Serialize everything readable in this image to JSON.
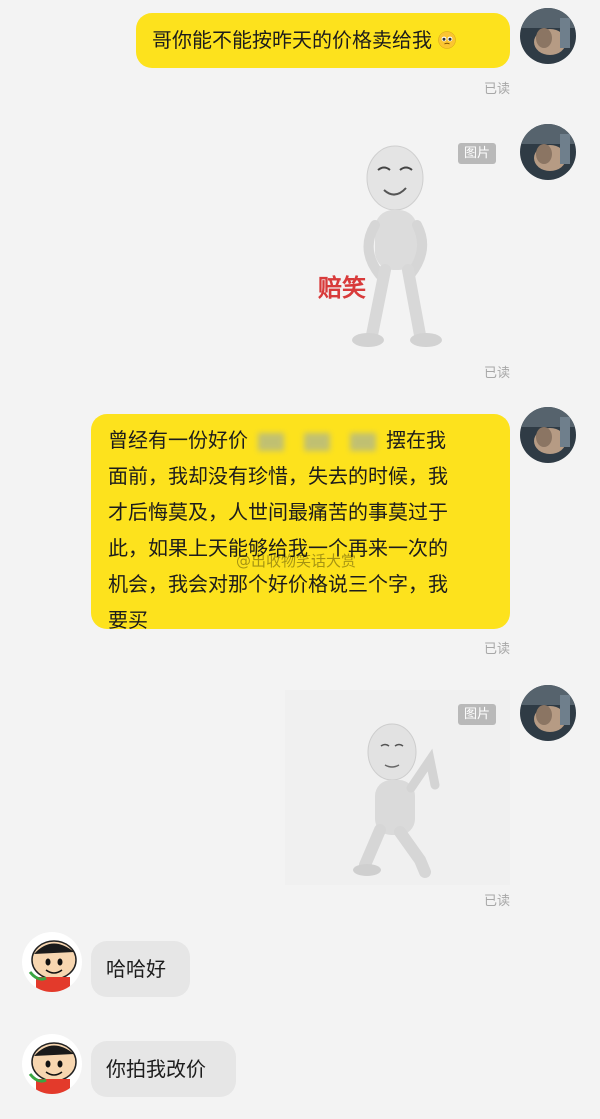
{
  "colors": {
    "my_bubble": "#fde21d",
    "their_bubble": "#e6e6e6",
    "background": "#f3f3f3",
    "read_text": "#a7a7a7"
  },
  "messages": [
    {
      "sender": "me",
      "text": "哥你能不能按昨天的价格卖给我",
      "emoji": "pleading-face",
      "status": "已读"
    },
    {
      "sender": "me",
      "type": "image",
      "badge": "图片",
      "caption": "赔笑",
      "status": "已读"
    },
    {
      "sender": "me",
      "lines": [
        "曾经有一份好价",
        "摆在我",
        "面前，我却没有珍惜，失去的时候，我",
        "才后悔莫及，人世间最痛苦的事莫过于",
        "此，如果上天能够给我一个再来一次的",
        "机会，我会对那个好价格说三个字，我",
        "要买"
      ],
      "status": "已读"
    },
    {
      "sender": "me",
      "type": "image",
      "badge": "图片",
      "status": "已读"
    },
    {
      "sender": "them",
      "text": "哈哈好"
    },
    {
      "sender": "them",
      "text": "你拍我改价"
    }
  ],
  "watermark": "@出收物笑话大赏"
}
